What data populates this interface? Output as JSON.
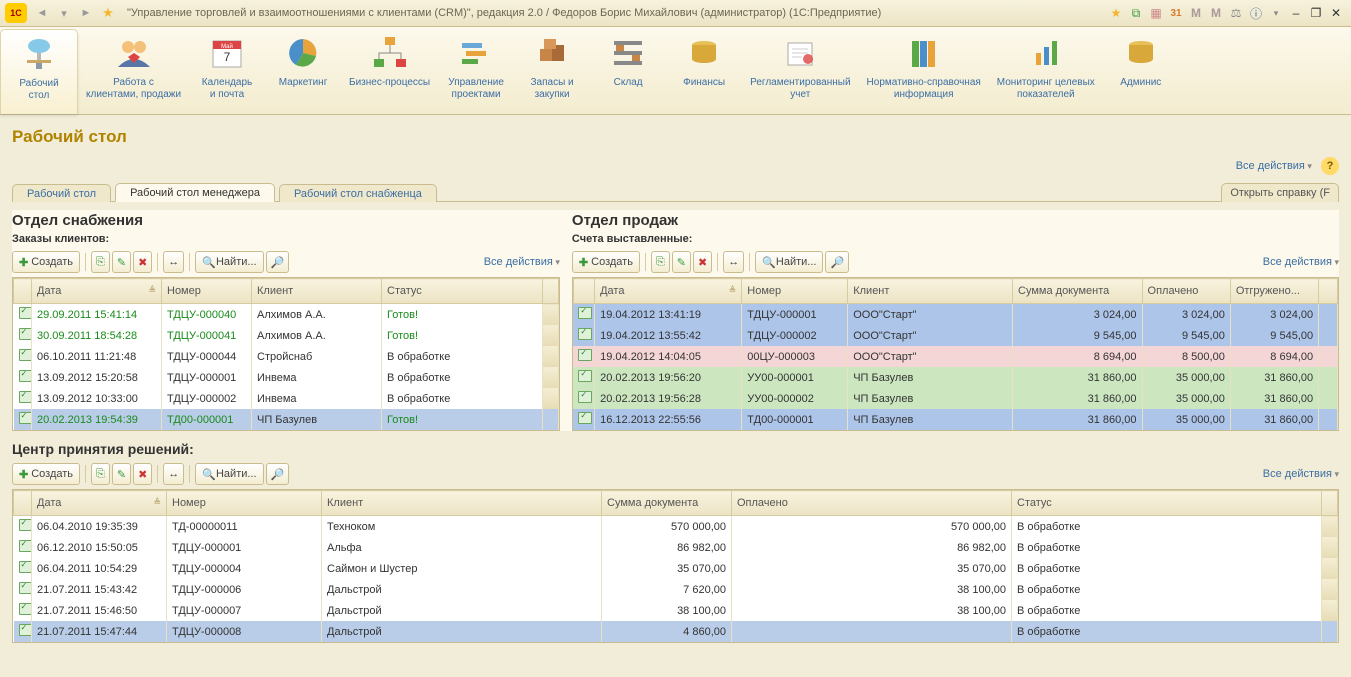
{
  "title": "\"Управление торговлей и взаимоотношениями с клиентами (CRM)\", редакция 2.0 / Федоров Борис Михайлович (администратор)  (1С:Предприятие)",
  "maintabs": [
    {
      "label": "Рабочий\nстол"
    },
    {
      "label": "Работа с\nклиентами, продажи"
    },
    {
      "label": "Календарь\nи почта"
    },
    {
      "label": "Маркетинг"
    },
    {
      "label": "Бизнес-процессы"
    },
    {
      "label": "Управление\nпроектами"
    },
    {
      "label": "Запасы и\nзакупки"
    },
    {
      "label": "Склад"
    },
    {
      "label": "Финансы"
    },
    {
      "label": "Регламентированный\nучет"
    },
    {
      "label": "Нормативно-справочная\nинформация"
    },
    {
      "label": "Мониторинг целевых\nпоказателей"
    },
    {
      "label": "Админис"
    }
  ],
  "page_title": "Рабочий стол",
  "all_actions": "Все действия",
  "tabs": {
    "t1": "Рабочий стол",
    "t2": "Рабочий стол менеджера",
    "t3": "Рабочий стол снабженца",
    "right": "Открыть справку (F"
  },
  "toolbar": {
    "create": "Создать",
    "find": "Найти..."
  },
  "supply": {
    "title": "Отдел снабжения",
    "sub": "Заказы клиентов:",
    "cols": {
      "date": "Дата",
      "num": "Номер",
      "client": "Клиент",
      "status": "Статус"
    },
    "rows": [
      {
        "date": "29.09.2011 15:41:14",
        "num": "ТДЦУ-000040",
        "client": "Алхимов А.А.",
        "status": "Готов!",
        "g": true
      },
      {
        "date": "30.09.2011 18:54:28",
        "num": "ТДЦУ-000041",
        "client": "Алхимов А.А.",
        "status": "Готов!",
        "g": true
      },
      {
        "date": "06.10.2011 11:21:48",
        "num": "ТДЦУ-000044",
        "client": "Стройснаб",
        "status": "В обработке"
      },
      {
        "date": "13.09.2012 15:20:58",
        "num": "ТДЦУ-000001",
        "client": "Инвема",
        "status": "В обработке"
      },
      {
        "date": "13.09.2012 10:33:00",
        "num": "ТДЦУ-000002",
        "client": "Инвема",
        "status": "В обработке"
      },
      {
        "date": "20.02.2013 19:54:39",
        "num": "ТД00-000001",
        "client": "ЧП Базулев",
        "status": "Готов!",
        "g": true,
        "sel": true
      }
    ]
  },
  "sales": {
    "title": "Отдел продаж",
    "sub": "Счета выставленные:",
    "cols": {
      "date": "Дата",
      "num": "Номер",
      "client": "Клиент",
      "sum": "Сумма документа",
      "paid": "Оплачено",
      "ship": "Отгружено..."
    },
    "rows": [
      {
        "date": "19.04.2012 13:41:19",
        "num": "ТДЦУ-000001",
        "client": "ООО\"Старт\"",
        "sum": "3 024,00",
        "paid": "3 024,00",
        "ship": "3 024,00",
        "cls": "sel2"
      },
      {
        "date": "19.04.2012 13:55:42",
        "num": "ТДЦУ-000002",
        "client": "ООО\"Старт\"",
        "sum": "9 545,00",
        "paid": "9 545,00",
        "ship": "9 545,00",
        "cls": "sel2"
      },
      {
        "date": "19.04.2012 14:04:05",
        "num": "00ЦУ-000003",
        "client": "ООО\"Старт\"",
        "sum": "8 694,00",
        "paid": "8 500,00",
        "ship": "8 694,00",
        "cls": "bg-pink"
      },
      {
        "date": "20.02.2013 19:56:20",
        "num": "УУ00-000001",
        "client": "ЧП Базулев",
        "sum": "31 860,00",
        "paid": "35 000,00",
        "ship": "31 860,00",
        "cls": "bg-green"
      },
      {
        "date": "20.02.2013 19:56:28",
        "num": "УУ00-000002",
        "client": "ЧП Базулев",
        "sum": "31 860,00",
        "paid": "35 000,00",
        "ship": "31 860,00",
        "cls": "bg-green"
      },
      {
        "date": "16.12.2013 22:55:56",
        "num": "ТД00-000001",
        "client": "ЧП Базулев",
        "sum": "31 860,00",
        "paid": "35 000,00",
        "ship": "31 860,00",
        "cls": "sel2"
      }
    ]
  },
  "center": {
    "title": "Центр принятия решений:",
    "cols": {
      "date": "Дата",
      "num": "Номер",
      "client": "Клиент",
      "sum": "Сумма документа",
      "paid": "Оплачено",
      "status": "Статус"
    },
    "rows": [
      {
        "date": "06.04.2010 19:35:39",
        "num": "ТД-00000011",
        "client": "Техноком",
        "sum": "570 000,00",
        "paid": "570 000,00",
        "status": "В обработке"
      },
      {
        "date": "06.12.2010 15:50:05",
        "num": "ТДЦУ-000001",
        "client": "Альфа",
        "sum": "86 982,00",
        "paid": "86 982,00",
        "status": "В обработке"
      },
      {
        "date": "06.04.2011 10:54:29",
        "num": "ТДЦУ-000004",
        "client": "Саймон и Шустер",
        "sum": "35 070,00",
        "paid": "35 070,00",
        "status": "В обработке"
      },
      {
        "date": "21.07.2011 15:43:42",
        "num": "ТДЦУ-000006",
        "client": "Дальстрой",
        "sum": "7 620,00",
        "paid": "38 100,00",
        "status": "В обработке"
      },
      {
        "date": "21.07.2011 15:46:50",
        "num": "ТДЦУ-000007",
        "client": "Дальстрой",
        "sum": "38 100,00",
        "paid": "38 100,00",
        "status": "В обработке"
      },
      {
        "date": "21.07.2011 15:47:44",
        "num": "ТДЦУ-000008",
        "client": "Дальстрой",
        "sum": "4 860,00",
        "paid": "",
        "status": "В обработке",
        "sel": true
      }
    ]
  }
}
